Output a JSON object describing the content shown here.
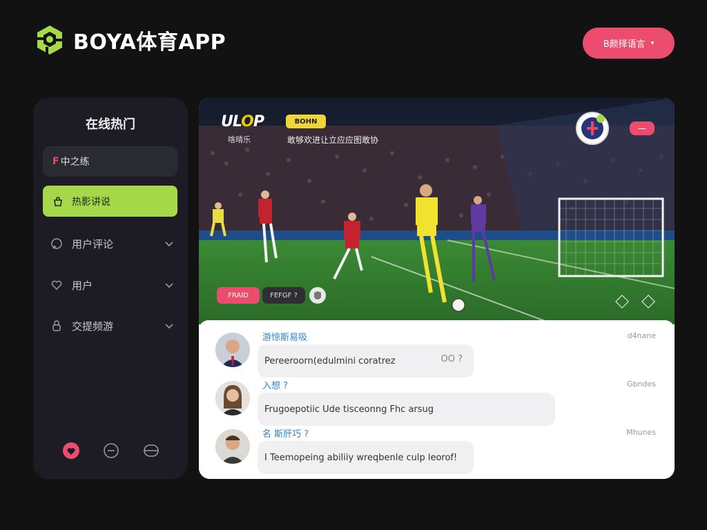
{
  "header": {
    "brand": "BOYA体育APP",
    "lang_button": "B颜择语言",
    "colors": {
      "accent_green": "#a6d84a",
      "accent_pink": "#ec4d6f",
      "background": "#121212"
    }
  },
  "sidebar": {
    "title": "在线热门",
    "items": [
      {
        "label_red": "F",
        "label": "中之练",
        "icon": "none"
      },
      {
        "label": "热影讲说",
        "icon": "bag-icon",
        "active": true
      },
      {
        "label": "用户评论",
        "icon": "chat-icon"
      },
      {
        "label": "用户",
        "icon": "heart-icon"
      },
      {
        "label": "交提频游",
        "icon": "lock-icon"
      }
    ],
    "bottom_icons": [
      "heart-filled-icon",
      "clock-icon",
      "box-icon"
    ]
  },
  "video": {
    "logo_prefix": "UL",
    "logo_o": "O",
    "logo_suffix": "P",
    "subtitle": "啥晴乐",
    "badge": "BOHN",
    "caption": "敢够欢进让立应应图敢协",
    "pink_tag": "一",
    "control_pink": "FRAID",
    "control_dark": "FEFGF ?",
    "control_round_icon": "shield-icon"
  },
  "comments": [
    {
      "name": "游惊斯易吸",
      "text": "Pereeroorn(edulmini coratrez",
      "reaction": "OO ?",
      "time": "d4nane"
    },
    {
      "name": "入想 ?",
      "text": "Frugoepotiic Ude tisceonng Fhc arsug",
      "reaction": "",
      "time": "Gbndes"
    },
    {
      "name": "名 斯肝巧 ?",
      "text": "I Teemopeing abiliiy wreqbenle culp leorof!",
      "reaction": "",
      "time": "Mhunes"
    }
  ]
}
